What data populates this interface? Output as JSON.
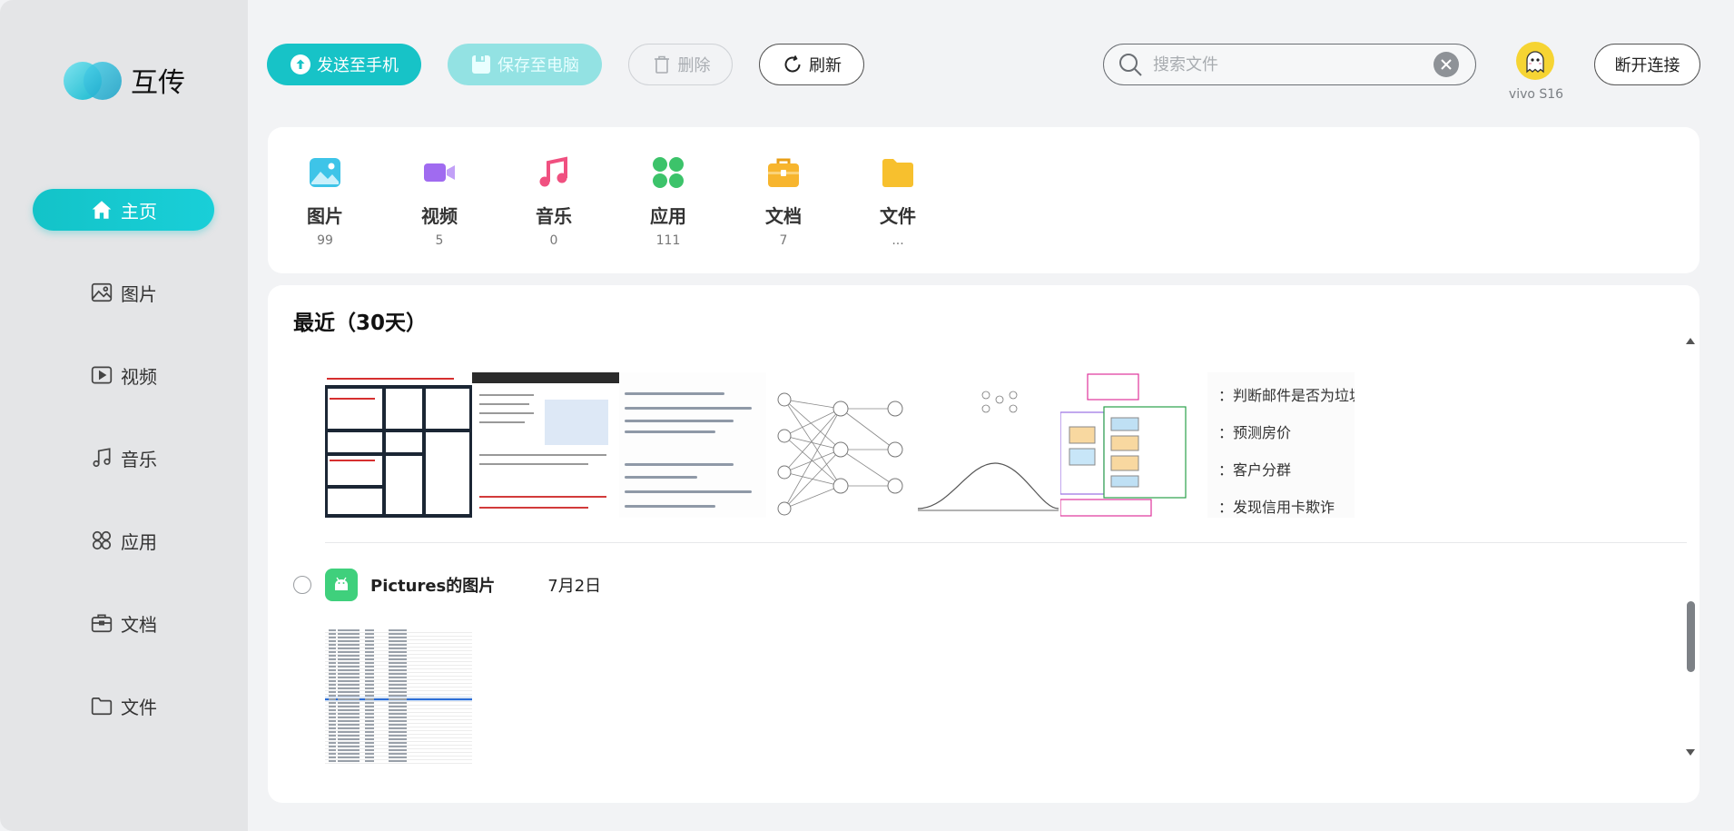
{
  "app": {
    "name": "互传"
  },
  "sidebar": {
    "items": [
      {
        "label": "主页",
        "icon": "home-icon",
        "active": true
      },
      {
        "label": "图片",
        "icon": "image-icon"
      },
      {
        "label": "视频",
        "icon": "video-icon"
      },
      {
        "label": "音乐",
        "icon": "music-icon"
      },
      {
        "label": "应用",
        "icon": "apps-icon"
      },
      {
        "label": "文档",
        "icon": "briefcase-icon"
      },
      {
        "label": "文件",
        "icon": "folder-icon"
      }
    ]
  },
  "toolbar": {
    "send_label": "发送至手机",
    "save_label": "保存至电脑",
    "delete_label": "删除",
    "refresh_label": "刷新",
    "disconnect_label": "断开连接"
  },
  "search": {
    "placeholder": "搜索文件",
    "value": ""
  },
  "device": {
    "name": "vivo S16"
  },
  "categories": [
    {
      "name": "图片",
      "count": "99",
      "icon": "image-category-icon",
      "color": "#3ec4e8"
    },
    {
      "name": "视频",
      "count": "5",
      "icon": "video-category-icon",
      "color": "#a06bf0"
    },
    {
      "name": "音乐",
      "count": "0",
      "icon": "music-category-icon",
      "color": "#f05080"
    },
    {
      "name": "应用",
      "count": "111",
      "icon": "apps-category-icon",
      "color": "#3cc36a"
    },
    {
      "name": "文档",
      "count": "7",
      "icon": "document-category-icon",
      "color": "#f7b52e"
    },
    {
      "name": "文件",
      "count": "...",
      "icon": "folder-category-icon",
      "color": "#f7c02e"
    }
  ],
  "recent": {
    "title": "最近（30天）",
    "groups": [
      {
        "bullets": [
          "：判断邮件是否为垃圾",
          "：预测房价",
          "：客户分群",
          "：发现信用卡欺诈"
        ]
      },
      {
        "name": "Pictures的图片",
        "date": "7月2日"
      }
    ]
  },
  "colors": {
    "accent": "#17c3c7",
    "accent_light": "#93e2e3",
    "category_card": "#ffffff"
  }
}
